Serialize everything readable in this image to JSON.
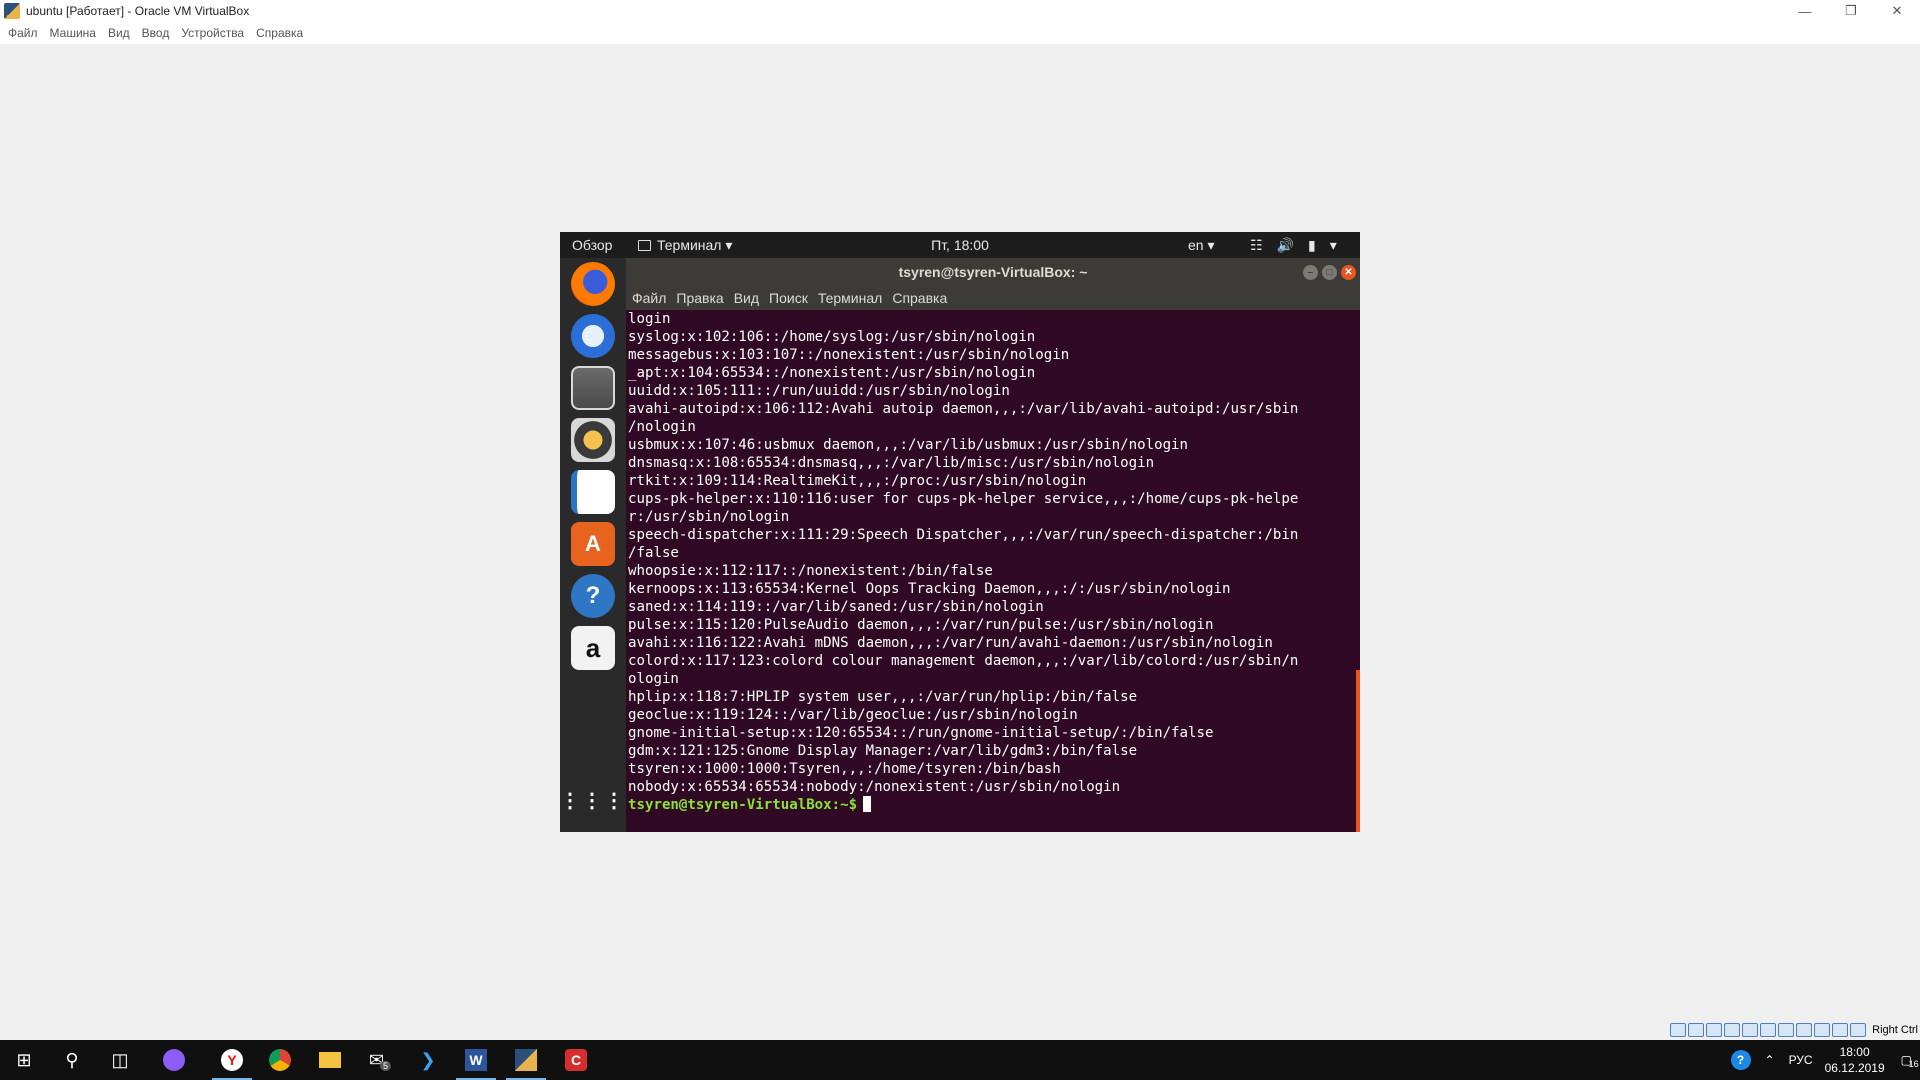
{
  "host": {
    "window_title": "ubuntu [Работает] - Oracle VM VirtualBox",
    "menu": [
      "Файл",
      "Машина",
      "Вид",
      "Ввод",
      "Устройства",
      "Справка"
    ],
    "status_right": "Right Ctrl"
  },
  "guest_topbar": {
    "activities": "Обзор",
    "app_menu": "Терминал ▾",
    "clock": "Пт, 18:00",
    "lang": "en ▾"
  },
  "terminal": {
    "title": "tsyren@tsyren-VirtualBox: ~",
    "menu": [
      "Файл",
      "Правка",
      "Вид",
      "Поиск",
      "Терминал",
      "Справка"
    ],
    "lines": [
      "login",
      "syslog:x:102:106::/home/syslog:/usr/sbin/nologin",
      "messagebus:x:103:107::/nonexistent:/usr/sbin/nologin",
      "_apt:x:104:65534::/nonexistent:/usr/sbin/nologin",
      "uuidd:x:105:111::/run/uuidd:/usr/sbin/nologin",
      "avahi-autoipd:x:106:112:Avahi autoip daemon,,,:/var/lib/avahi-autoipd:/usr/sbin",
      "/nologin",
      "usbmux:x:107:46:usbmux daemon,,,:/var/lib/usbmux:/usr/sbin/nologin",
      "dnsmasq:x:108:65534:dnsmasq,,,:/var/lib/misc:/usr/sbin/nologin",
      "rtkit:x:109:114:RealtimeKit,,,:/proc:/usr/sbin/nologin",
      "cups-pk-helper:x:110:116:user for cups-pk-helper service,,,:/home/cups-pk-helpe",
      "r:/usr/sbin/nologin",
      "speech-dispatcher:x:111:29:Speech Dispatcher,,,:/var/run/speech-dispatcher:/bin",
      "/false",
      "whoopsie:x:112:117::/nonexistent:/bin/false",
      "kernoops:x:113:65534:Kernel Oops Tracking Daemon,,,:/:/usr/sbin/nologin",
      "saned:x:114:119::/var/lib/saned:/usr/sbin/nologin",
      "pulse:x:115:120:PulseAudio daemon,,,:/var/run/pulse:/usr/sbin/nologin",
      "avahi:x:116:122:Avahi mDNS daemon,,,:/var/run/avahi-daemon:/usr/sbin/nologin",
      "colord:x:117:123:colord colour management daemon,,,:/var/lib/colord:/usr/sbin/n",
      "ologin",
      "hplip:x:118:7:HPLIP system user,,,:/var/run/hplip:/bin/false",
      "geoclue:x:119:124::/var/lib/geoclue:/usr/sbin/nologin",
      "gnome-initial-setup:x:120:65534::/run/gnome-initial-setup/:/bin/false",
      "gdm:x:121:125:Gnome Display Manager:/var/lib/gdm3:/bin/false",
      "tsyren:x:1000:1000:Tsyren,,,:/home/tsyren:/bin/bash",
      "nobody:x:65534:65534:nobody:/nonexistent:/usr/sbin/nologin"
    ],
    "prompt": "tsyren@tsyren-VirtualBox:~$"
  },
  "dock_icons": [
    "firefox-icon",
    "thunderbird-icon",
    "files-icon",
    "rhythmbox-icon",
    "writer-icon",
    "software-icon",
    "help-icon",
    "amazon-icon",
    "show-apps-icon"
  ],
  "taskbar": {
    "mail_badge": "5",
    "lang": "РУС",
    "time": "18:00",
    "date": "06.12.2019",
    "notif_badge": "16"
  },
  "colors": {
    "terminal_bg": "#300a24",
    "prompt_green": "#8ae234",
    "ubuntu_orange": "#e95420",
    "taskbar_bg": "#101010"
  }
}
